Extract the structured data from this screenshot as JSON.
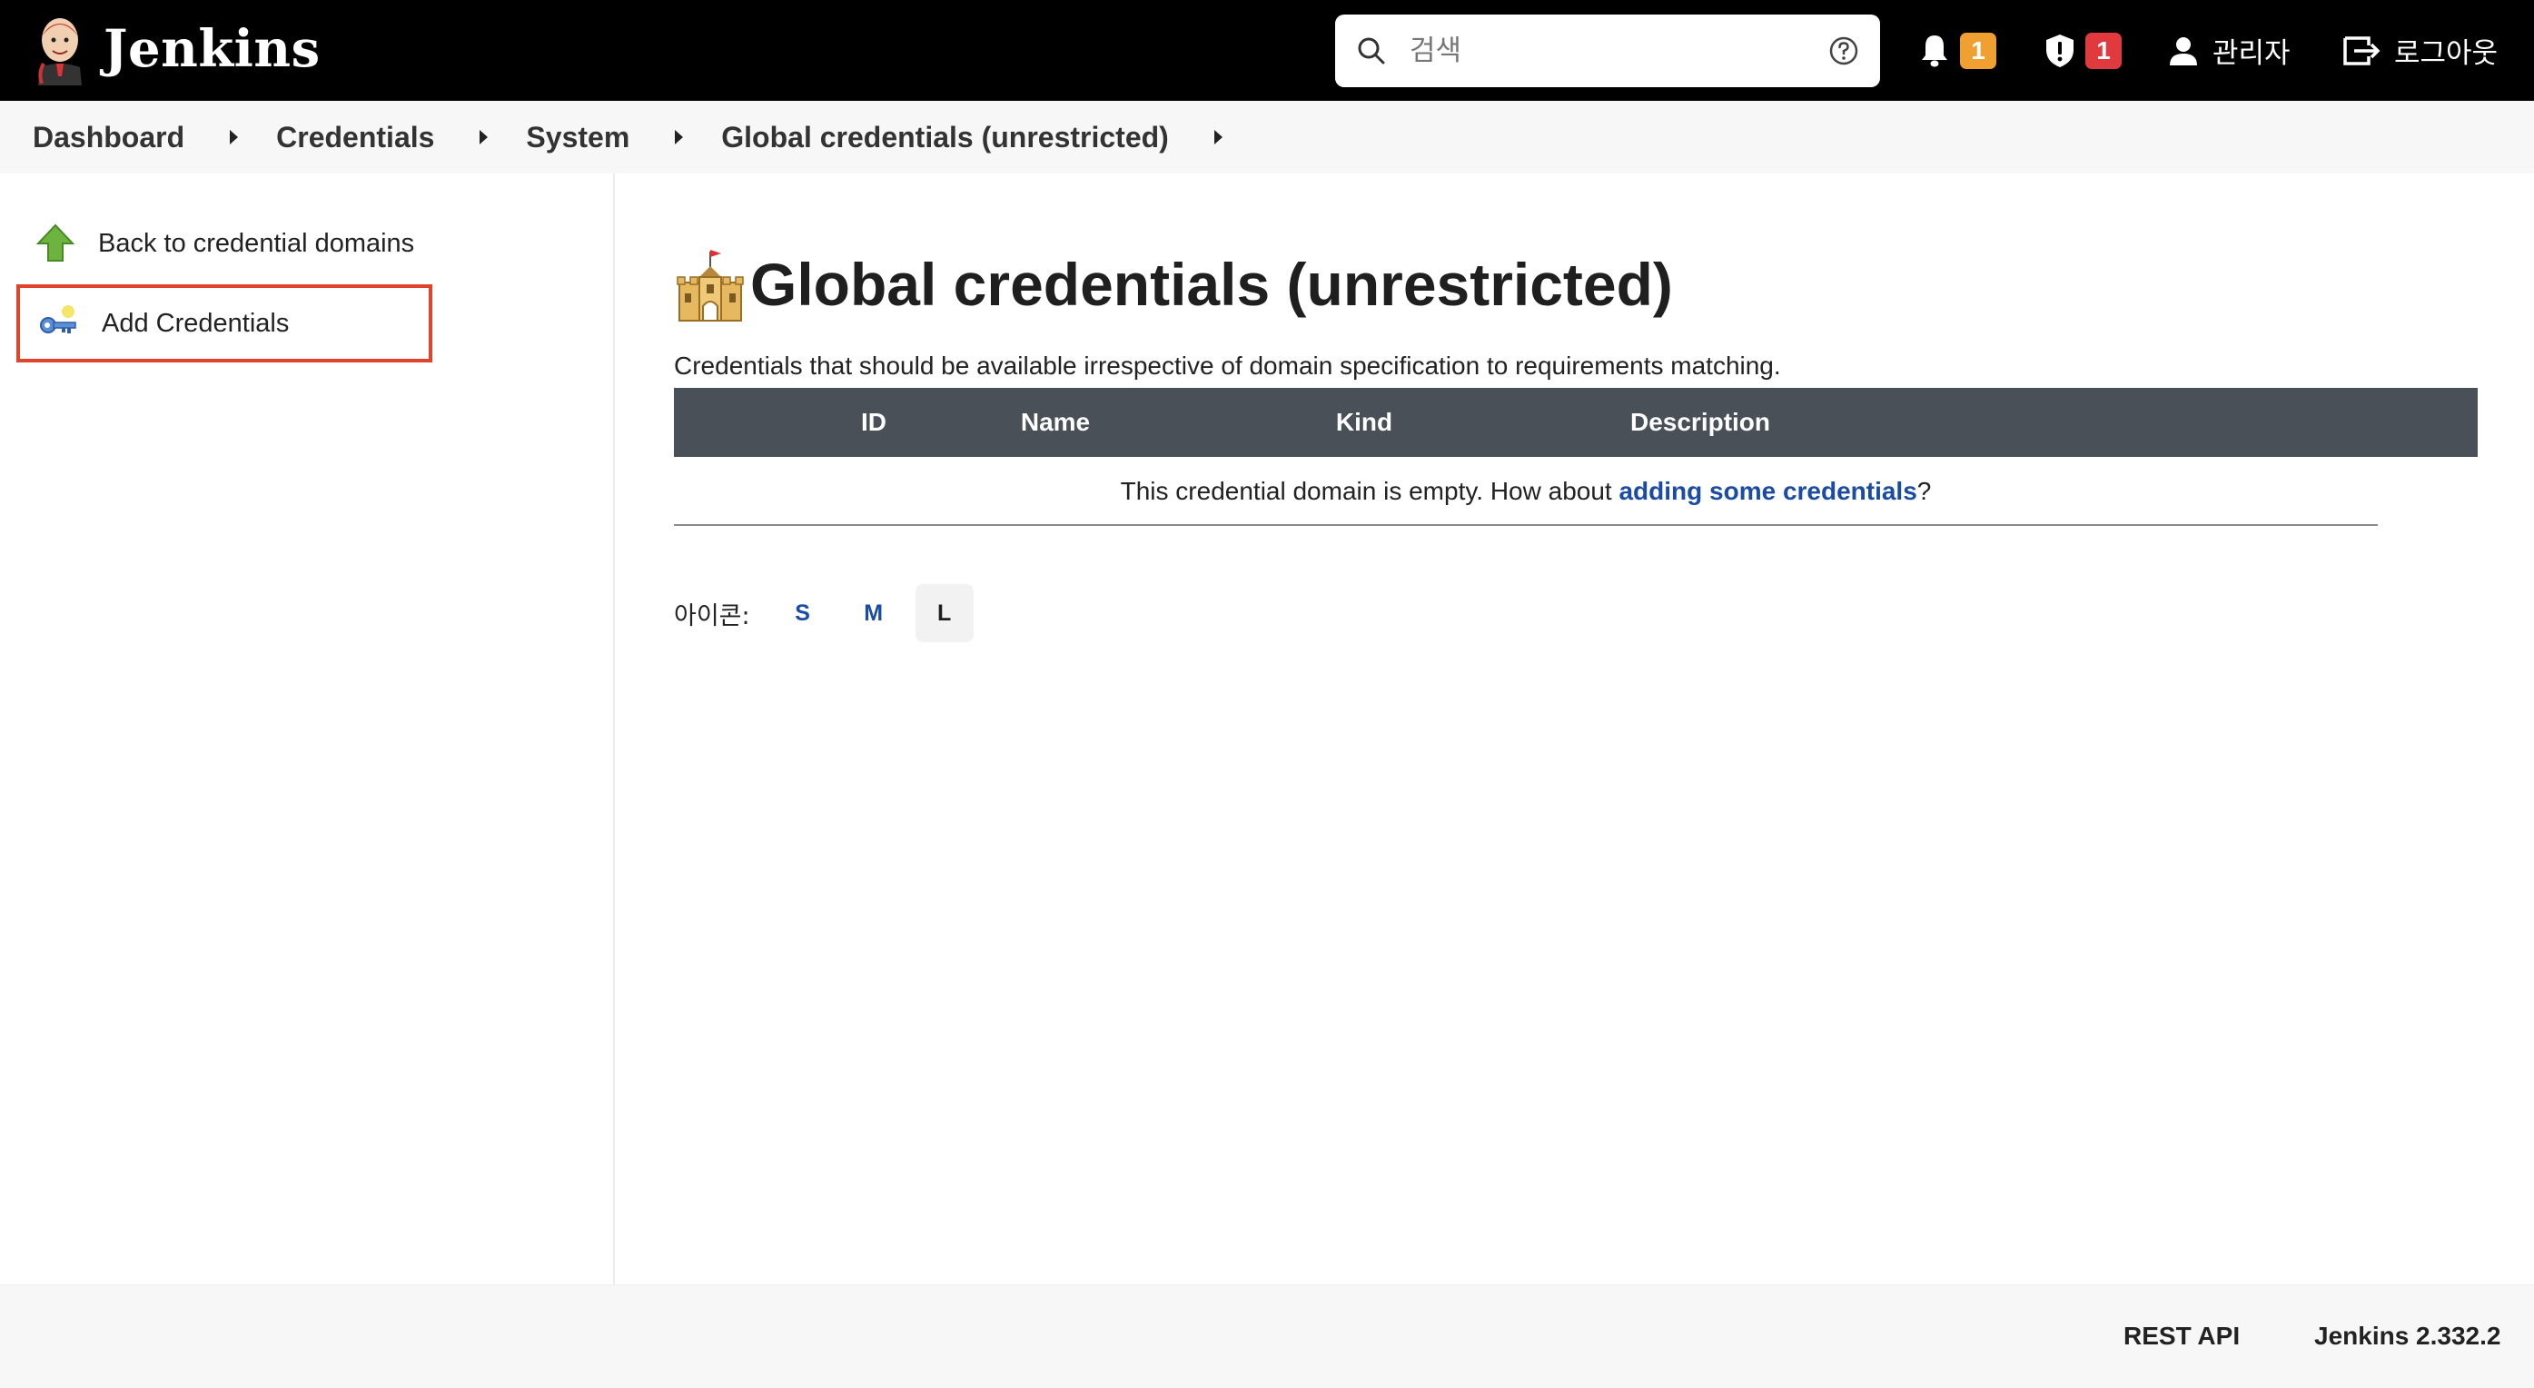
{
  "header": {
    "brand": "Jenkins",
    "search_placeholder": "검색",
    "notifications_count": "1",
    "security_count": "1",
    "user_label": "관리자",
    "logout_label": "로그아웃"
  },
  "breadcrumb": {
    "items": [
      "Dashboard",
      "Credentials",
      "System",
      "Global credentials (unrestricted)"
    ]
  },
  "sidebar": {
    "items": [
      {
        "label": "Back to credential domains",
        "icon": "arrow-up-icon"
      },
      {
        "label": "Add Credentials",
        "icon": "key-icon"
      }
    ]
  },
  "main": {
    "title": "Global credentials (unrestricted)",
    "description": "Credentials that should be available irrespective of domain specification to requirements matching.",
    "table": {
      "headers": [
        "ID",
        "Name",
        "Kind",
        "Description"
      ],
      "empty_prefix": "This credential domain is empty. How about ",
      "empty_link": "adding some credentials",
      "empty_suffix": "?"
    },
    "icon_size": {
      "label": "아이콘:",
      "options": [
        "S",
        "M",
        "L"
      ],
      "selected": "L"
    }
  },
  "footer": {
    "rest_api": "REST API",
    "version": "Jenkins 2.332.2"
  },
  "colors": {
    "header_bg": "#000000",
    "table_header_bg": "#4a5058",
    "link": "#1a4ba6",
    "badge_orange": "#f0a030",
    "badge_red": "#e03a3e",
    "highlight_border": "#e0442c"
  }
}
